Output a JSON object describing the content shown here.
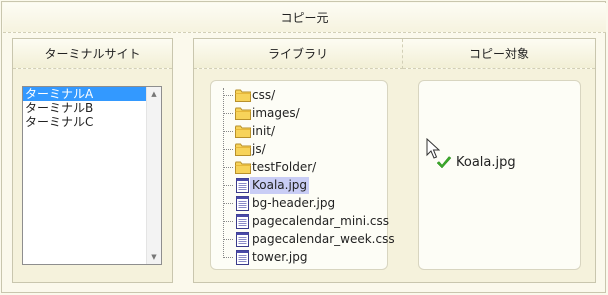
{
  "header": {
    "title": "コピー元"
  },
  "terminal_panel": {
    "title": "ターミナルサイト",
    "options": [
      "ターミナルA",
      "ターミナルB",
      "ターミナルC"
    ],
    "selected_index": 0
  },
  "library_panel": {
    "title": "ライブラリ",
    "tree": [
      {
        "label": "css/",
        "type": "folder"
      },
      {
        "label": "images/",
        "type": "folder"
      },
      {
        "label": "init/",
        "type": "folder"
      },
      {
        "label": "js/",
        "type": "folder"
      },
      {
        "label": "testFolder/",
        "type": "folder"
      },
      {
        "label": "Koala.jpg",
        "type": "file",
        "selected": true
      },
      {
        "label": "bg-header.jpg",
        "type": "file"
      },
      {
        "label": "pagecalendar_mini.css",
        "type": "file"
      },
      {
        "label": "pagecalendar_week.css",
        "type": "file"
      },
      {
        "label": "tower.jpg",
        "type": "file"
      }
    ]
  },
  "copy_target_panel": {
    "title": "コピー対象",
    "items": [
      {
        "label": "Koala.jpg",
        "icon": "green-check-icon"
      }
    ]
  },
  "colors": {
    "selection": "#3399ff",
    "tree_selection": "#c9cdf5",
    "check": "#3aa829"
  }
}
